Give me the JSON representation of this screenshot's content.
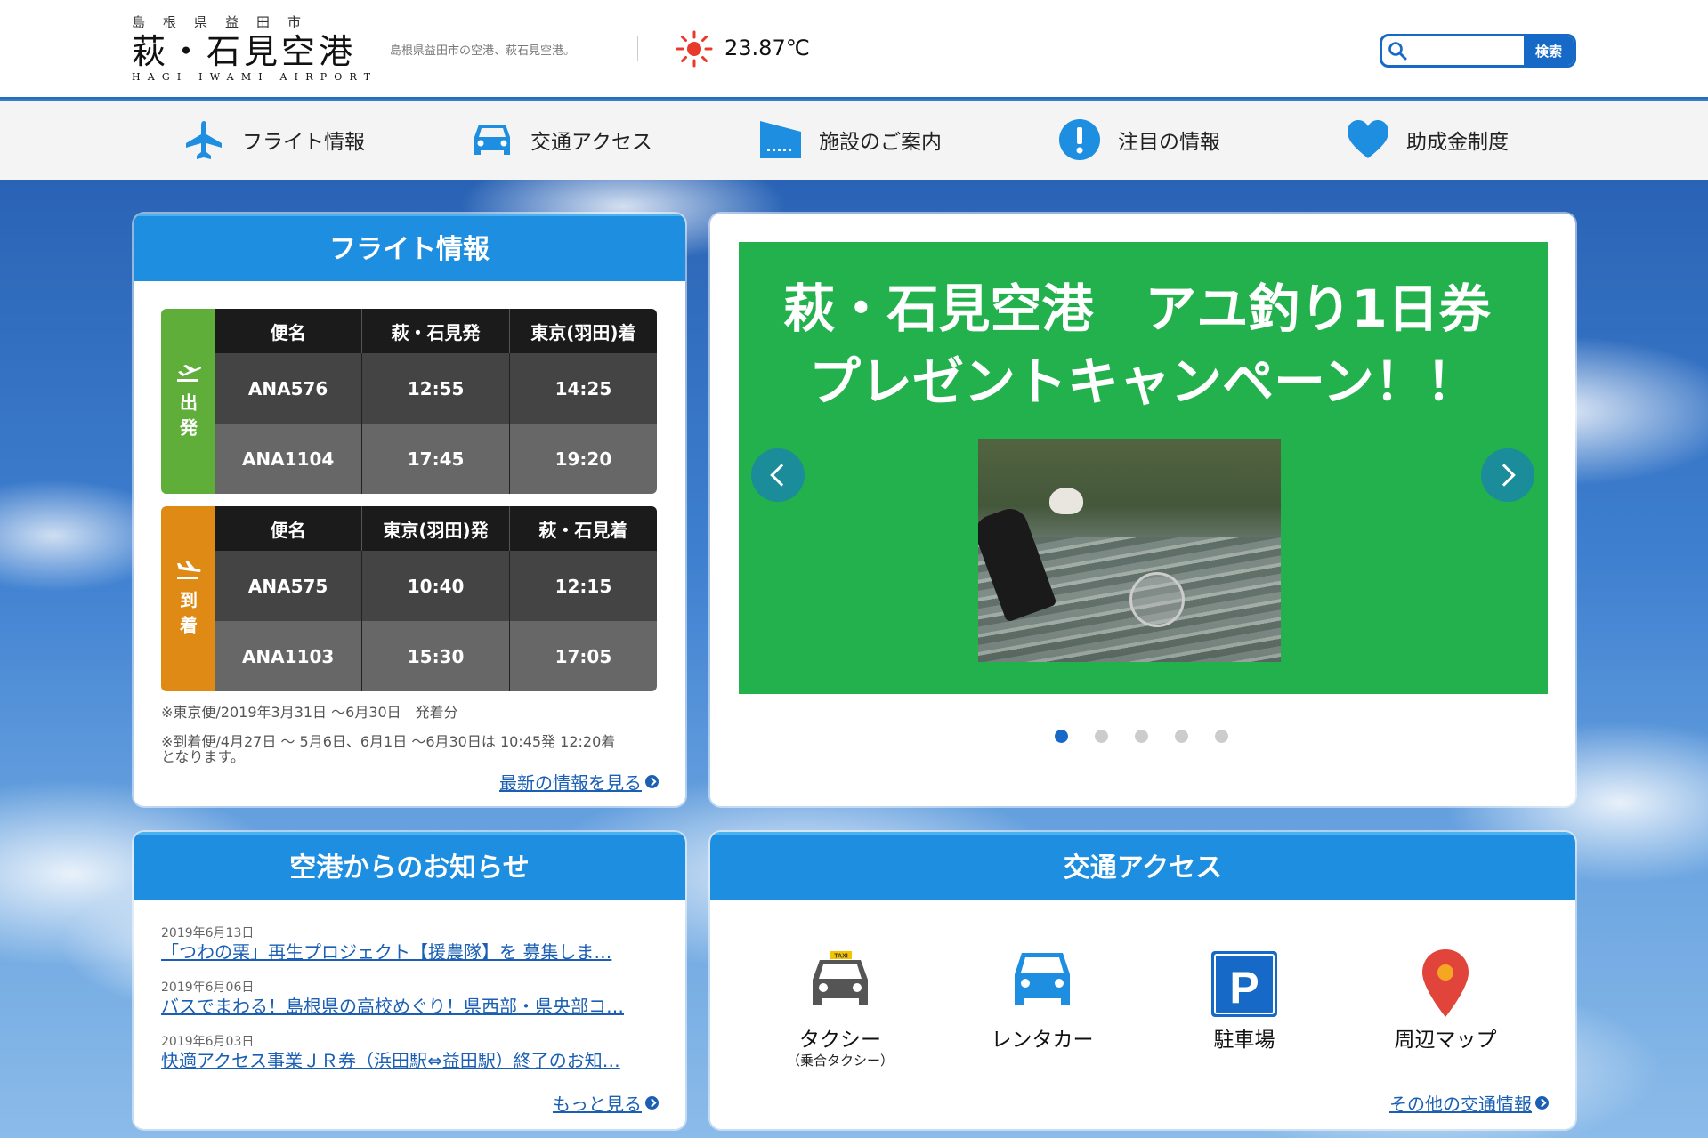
{
  "header": {
    "logo_top": "島根県益田市",
    "logo_main": "萩・石見空港",
    "logo_en": "HAGI IWAMI AIRPORT",
    "tagline": "島根県益田市の空港、萩石見空港。",
    "temperature": "23.87℃",
    "weather_icon": "sun-icon",
    "search_placeholder": "",
    "search_button": "検索"
  },
  "nav": {
    "items": [
      {
        "label": "フライト情報",
        "icon": "airplane-icon"
      },
      {
        "label": "交通アクセス",
        "icon": "car-icon"
      },
      {
        "label": "施設のご案内",
        "icon": "building-icon"
      },
      {
        "label": "注目の情報",
        "icon": "exclamation-icon"
      },
      {
        "label": "助成金制度",
        "icon": "heart-icon"
      }
    ]
  },
  "flight": {
    "title": "フライト情報",
    "departure": {
      "side_label": "出発",
      "headers": [
        "便名",
        "萩・石見発",
        "東京(羽田)着"
      ],
      "rows": [
        [
          "ANA576",
          "12:55",
          "14:25"
        ],
        [
          "ANA1104",
          "17:45",
          "19:20"
        ]
      ]
    },
    "arrival": {
      "side_label": "到着",
      "headers": [
        "便名",
        "東京(羽田)発",
        "萩・石見着"
      ],
      "rows": [
        [
          "ANA575",
          "10:40",
          "12:15"
        ],
        [
          "ANA1103",
          "15:30",
          "17:05"
        ]
      ]
    },
    "note1": "※東京便/2019年3月31日 ～6月30日　発着分",
    "note2_line1": "※到着便/4月27日 ～ 5月6日、6月1日 ～6月30日は 10:45発 12:20着",
    "note2_line2": "となります。",
    "more_link": "最新の情報を見る"
  },
  "slider": {
    "title_line1": "萩・石見空港　アユ釣り1日券",
    "title_line2": "プレゼントキャンペーン！！",
    "dot_count": 5,
    "active_dot": 1,
    "accent_color": "#22b14c"
  },
  "news": {
    "title": "空港からのお知らせ",
    "items": [
      {
        "date": "2019年6月13日",
        "title": "「つわの栗」再生プロジェクト【援農隊】を 募集しま…"
      },
      {
        "date": "2019年6月06日",
        "title": "バスでまわる！島根県の高校めぐり！県西部・県央部コ…"
      },
      {
        "date": "2019年6月03日",
        "title": "快適アクセス事業ＪＲ券（浜田駅⇔益田駅）終了のお知…"
      }
    ],
    "more_link": "もっと見る"
  },
  "access": {
    "title": "交通アクセス",
    "items": [
      {
        "label": "タクシー",
        "sub": "（乗合タクシー）",
        "icon": "taxi-icon"
      },
      {
        "label": "レンタカー",
        "sub": "",
        "icon": "rental-car-icon"
      },
      {
        "label": "駐車場",
        "sub": "",
        "icon": "parking-icon"
      },
      {
        "label": "周辺マップ",
        "sub": "",
        "icon": "map-pin-icon"
      }
    ],
    "more_link": "その他の交通情報"
  }
}
